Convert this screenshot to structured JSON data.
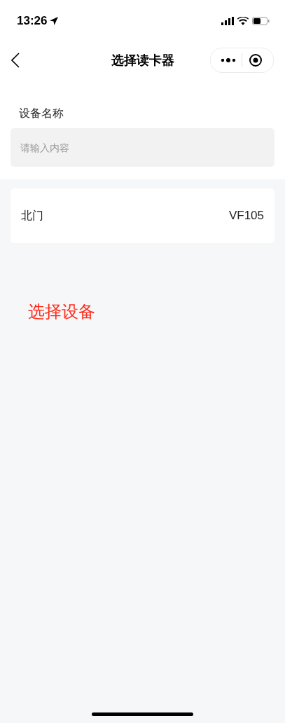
{
  "status_bar": {
    "time": "13:26"
  },
  "nav_bar": {
    "title": "选择读卡器"
  },
  "form": {
    "label": "设备名称",
    "placeholder": "请输入内容"
  },
  "devices": [
    {
      "name": "北门",
      "code": "VF105"
    }
  ],
  "annotation": {
    "text": "选择设备"
  }
}
